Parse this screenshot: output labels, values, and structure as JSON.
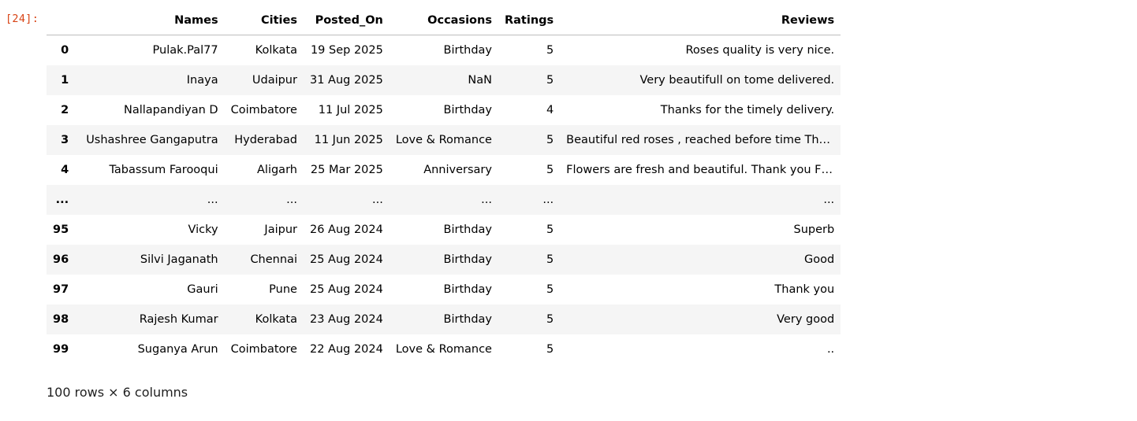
{
  "cell": {
    "prompt": "[24]:",
    "summary": "100 rows × 6 columns"
  },
  "table": {
    "columns": [
      "Names",
      "Cities",
      "Posted_On",
      "Occasions",
      "Ratings",
      "Reviews"
    ],
    "rows": [
      {
        "index": "0",
        "cells": [
          "Pulak.Pal77",
          "Kolkata",
          "19 Sep 2025",
          "Birthday",
          "5",
          "Roses quality is very nice."
        ]
      },
      {
        "index": "1",
        "cells": [
          "Inaya",
          "Udaipur",
          "31 Aug 2025",
          "NaN",
          "5",
          "Very beautifull on tome delivered."
        ]
      },
      {
        "index": "2",
        "cells": [
          "Nallapandiyan D",
          "Coimbatore",
          "11 Jul 2025",
          "Birthday",
          "4",
          "Thanks for the timely delivery."
        ]
      },
      {
        "index": "3",
        "cells": [
          "Ushashree Gangaputra",
          "Hyderabad",
          "11 Jun 2025",
          "Love & Romance",
          "5",
          "Beautiful red roses , reached before time Than..."
        ]
      },
      {
        "index": "4",
        "cells": [
          "Tabassum Farooqui",
          "Aligarh",
          "25 Mar 2025",
          "Anniversary",
          "5",
          "Flowers are fresh and beautiful. Thank you Flo..."
        ]
      },
      {
        "index": "...",
        "cells": [
          "...",
          "...",
          "...",
          "...",
          "...",
          "..."
        ]
      },
      {
        "index": "95",
        "cells": [
          "Vicky",
          "Jaipur",
          "26 Aug 2024",
          "Birthday",
          "5",
          "Superb"
        ]
      },
      {
        "index": "96",
        "cells": [
          "Silvi Jaganath",
          "Chennai",
          "25 Aug 2024",
          "Birthday",
          "5",
          "Good"
        ]
      },
      {
        "index": "97",
        "cells": [
          "Gauri",
          "Pune",
          "25 Aug 2024",
          "Birthday",
          "5",
          "Thank you"
        ]
      },
      {
        "index": "98",
        "cells": [
          "Rajesh Kumar",
          "Kolkata",
          "23 Aug 2024",
          "Birthday",
          "5",
          "Very good"
        ]
      },
      {
        "index": "99",
        "cells": [
          "Suganya Arun",
          "Coimbatore",
          "22 Aug 2024",
          "Love & Romance",
          "5",
          ".."
        ]
      }
    ]
  }
}
